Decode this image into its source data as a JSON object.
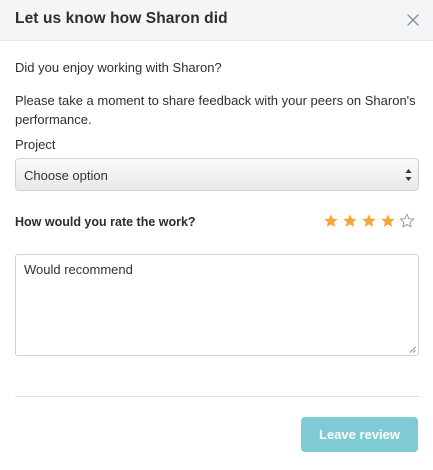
{
  "dialog": {
    "title": "Let us know how Sharon did"
  },
  "form": {
    "question": "Did you enjoy working with Sharon?",
    "prompt": "Please take a moment to share feedback with your peers on Sharon's performance.",
    "project_label": "Project",
    "project_value": "Choose option",
    "rating_label": "How would you rate the work?",
    "rating": 4,
    "rating_max": 5,
    "review_text": "Would recommend",
    "submit_label": "Leave review"
  },
  "colors": {
    "star_filled": "#f0a83a",
    "star_empty": "#9aa0a6",
    "submit_bg": "#7fcbd3"
  },
  "icons": {
    "close": "close-icon",
    "select_arrows": "select-arrows-icon",
    "star": "star-icon",
    "resize": "resize-handle-icon"
  }
}
